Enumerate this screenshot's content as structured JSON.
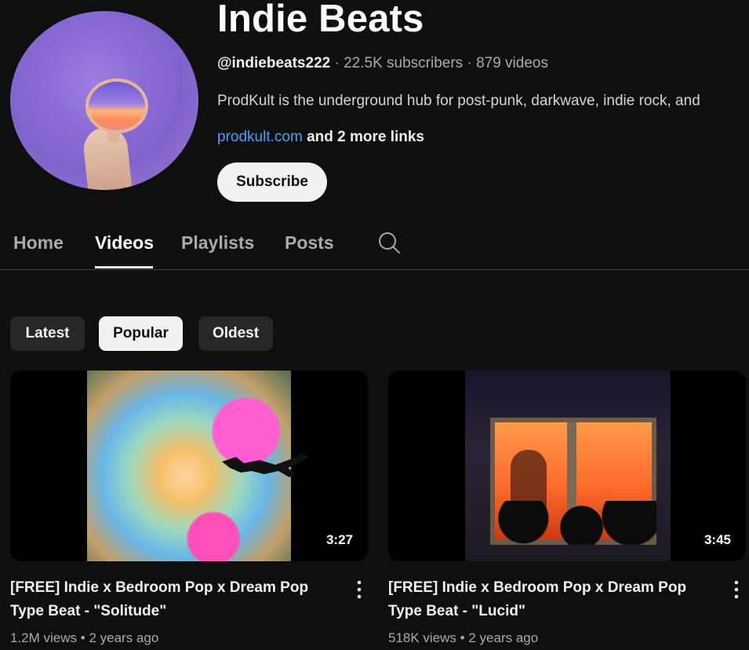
{
  "channel": {
    "name": "Indie Beats",
    "handle": "@indiebeats222",
    "subscribers": "22.5K subscribers",
    "videos": "879 videos",
    "description": "ProdKult is the underground hub for post-punk, darkwave, indie rock, and",
    "link": "prodkult.com",
    "more_links": "and 2 more links",
    "subscribe_label": "Subscribe"
  },
  "tabs": [
    {
      "label": "Home",
      "active": false
    },
    {
      "label": "Videos",
      "active": true
    },
    {
      "label": "Playlists",
      "active": false
    },
    {
      "label": "Posts",
      "active": false
    }
  ],
  "chips": [
    {
      "label": "Latest",
      "selected": false
    },
    {
      "label": "Popular",
      "selected": true
    },
    {
      "label": "Oldest",
      "selected": false
    }
  ],
  "videos": [
    {
      "title": "[FREE] Indie x Bedroom Pop x Dream Pop Type Beat - \"Solitude\"",
      "duration": "3:27",
      "views": "1.2M views",
      "age": "2 years ago"
    },
    {
      "title": "[FREE] Indie x Bedroom Pop x Dream Pop Type Beat - \"Lucid\"",
      "duration": "3:45",
      "views": "518K views",
      "age": "2 years ago"
    }
  ],
  "icons": {
    "search": "search-icon",
    "more": "more-vert-icon"
  },
  "colors": {
    "background": "#0f0f0f",
    "link": "#3ea6ff",
    "chip": "#272727",
    "chip_selected": "#f1f1f1"
  }
}
